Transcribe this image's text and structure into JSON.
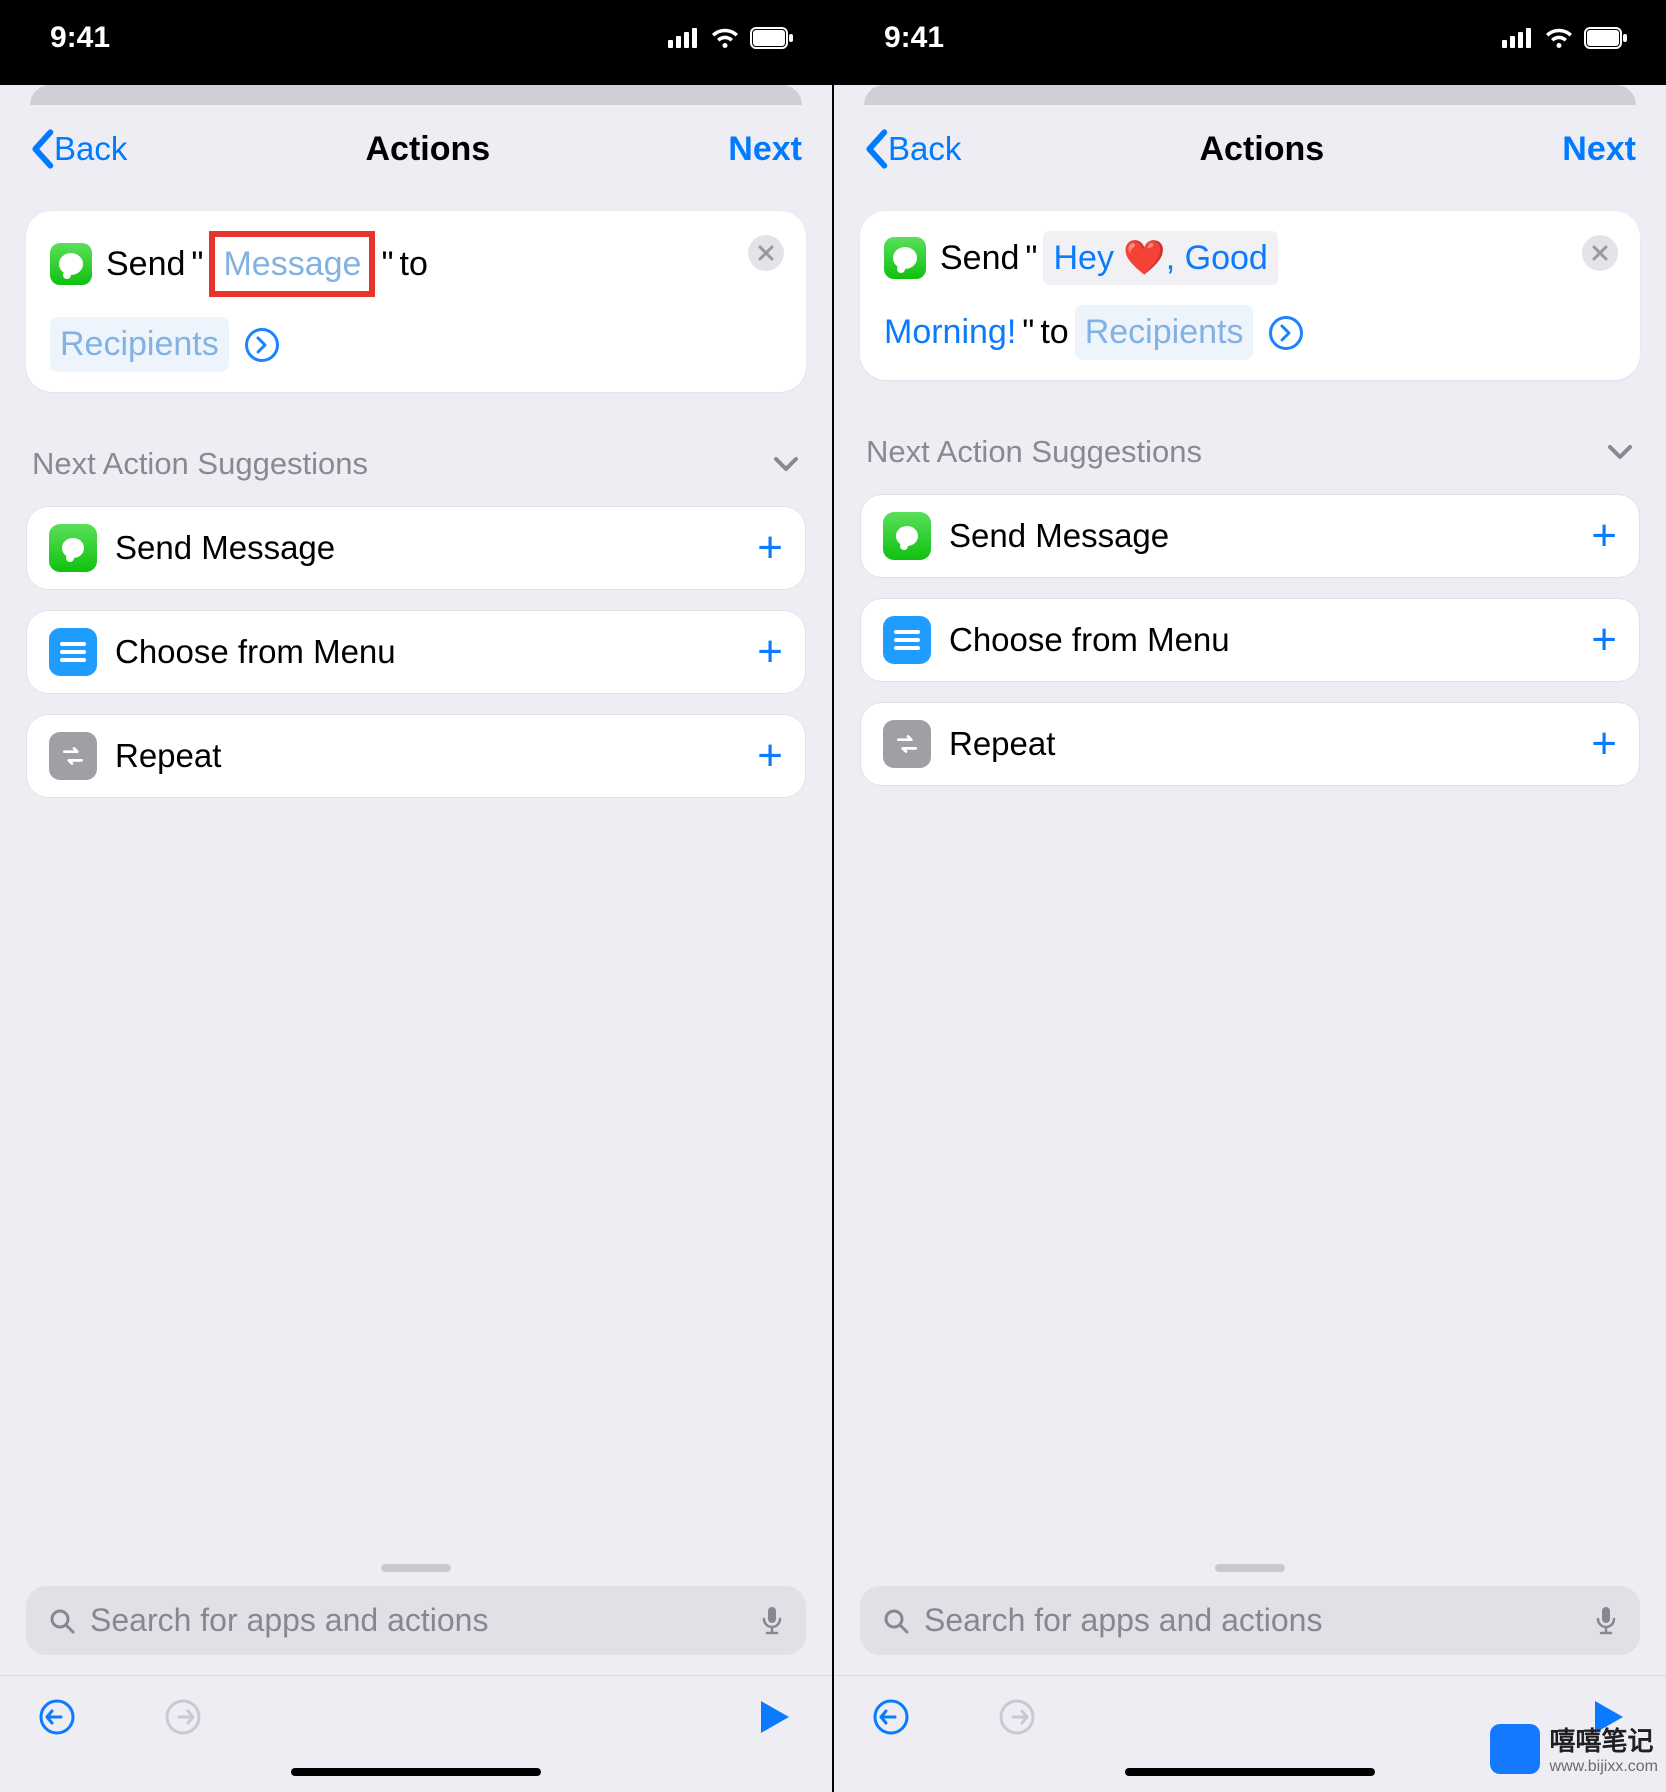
{
  "status": {
    "time": "9:41"
  },
  "nav": {
    "back": "Back",
    "title": "Actions",
    "next": "Next"
  },
  "left_card": {
    "word_send": "Send",
    "quote_open": "\"",
    "message_token": "Message",
    "quote_close": "\"",
    "word_to": "to",
    "recipients_token": "Recipients"
  },
  "right_card": {
    "word_send": "Send",
    "quote_open": "\"",
    "msg_part1": "Hey ❤️, Good",
    "msg_part2": "Morning!",
    "quote_close": "\"",
    "word_to": "to",
    "recipients_token": "Recipients"
  },
  "suggestions": {
    "header": "Next Action Suggestions",
    "items": [
      {
        "label": "Send Message",
        "icon": "message"
      },
      {
        "label": "Choose from Menu",
        "icon": "menu"
      },
      {
        "label": "Repeat",
        "icon": "repeat"
      }
    ]
  },
  "search": {
    "placeholder": "Search for apps and actions"
  },
  "watermark": {
    "title": "嘻嘻笔记",
    "url": "www.bijixx.com"
  }
}
